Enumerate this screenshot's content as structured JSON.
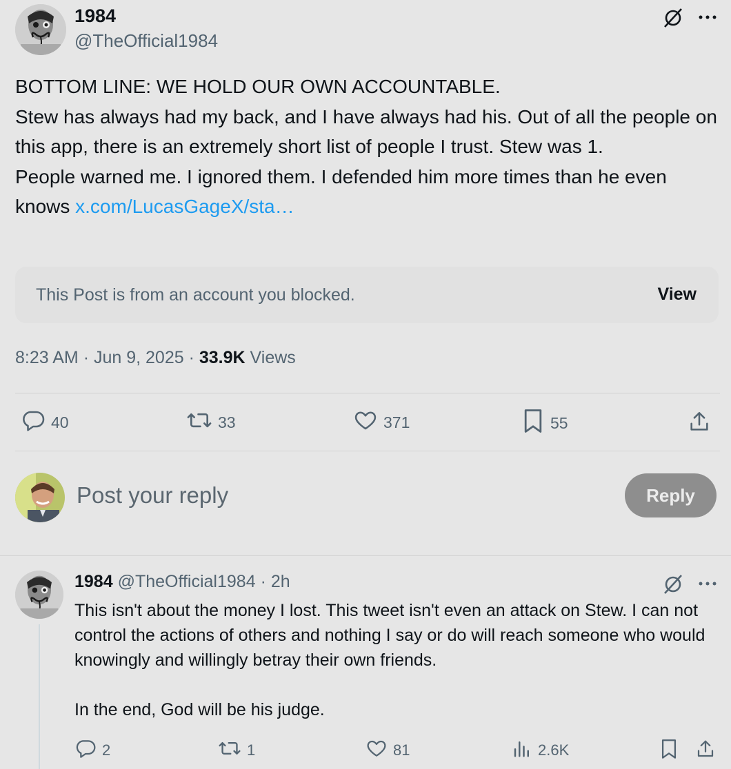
{
  "post": {
    "author_name": "1984",
    "author_handle": "@TheOfficial1984",
    "text_lines": [
      "BOTTOM LINE: WE HOLD OUR OWN ACCOUNTABLE.",
      "Stew has always had my back, and I have always had his. Out of all the people on this app, there is an extremely short list of people I trust.  Stew was 1.",
      "People warned me. I ignored them. I defended him more times than he even knows "
    ],
    "link_text": "x.com/LucasGageX/sta…",
    "blocked_notice": "This Post is from an account you blocked.",
    "blocked_view_label": "View",
    "time": "8:23 AM",
    "date": "Jun 9, 2025",
    "views_count": "33.9K",
    "views_label": "Views",
    "separator": "·",
    "actions": {
      "replies": "40",
      "reposts": "33",
      "likes": "371",
      "bookmarks": "55"
    }
  },
  "composer": {
    "placeholder": "Post your reply",
    "button_label": "Reply"
  },
  "reply": {
    "author_name": "1984",
    "author_handle": "@TheOfficial1984",
    "separator": "·",
    "age": "2h",
    "text": "This isn't about the money I lost. This tweet isn't even an attack on Stew. I can not control the actions of others and nothing I say or do will reach someone who would knowingly and willingly betray their own friends.\n\nIn the end, God will be his judge.",
    "actions": {
      "replies": "2",
      "reposts": "1",
      "likes": "81",
      "views": "2.6K"
    }
  },
  "icons": {
    "grok": "grok-icon",
    "more": "more-icon",
    "reply": "reply-icon",
    "repost": "repost-icon",
    "like": "like-icon",
    "bookmark": "bookmark-icon",
    "share": "share-icon",
    "views": "views-icon"
  },
  "colors": {
    "background": "#e6e6e6",
    "text": "#0f1419",
    "muted": "#536471",
    "link": "#1d9bf0",
    "reply_button": "#8e8e8e"
  }
}
